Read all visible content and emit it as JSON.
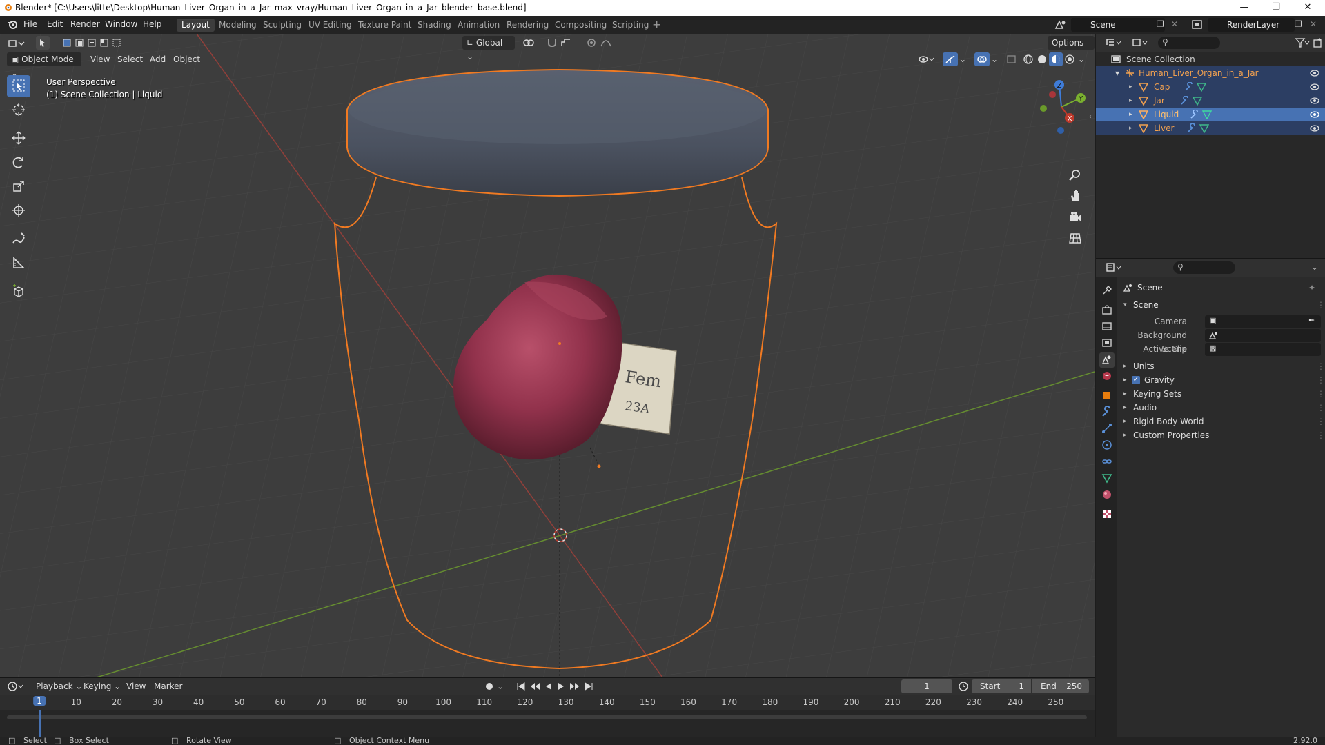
{
  "window": {
    "title": "Blender* [C:\\Users\\litte\\Desktop\\Human_Liver_Organ_in_a_Jar_max_vray/Human_Liver_Organ_in_a_Jar_blender_base.blend]"
  },
  "menu": [
    "File",
    "Edit",
    "Render",
    "Window",
    "Help"
  ],
  "workspaces": [
    "Layout",
    "Modeling",
    "Sculpting",
    "UV Editing",
    "Texture Paint",
    "Shading",
    "Animation",
    "Rendering",
    "Compositing",
    "Scripting"
  ],
  "active_workspace": "Layout",
  "scene_field": "Scene",
  "render_layer_field": "RenderLayer",
  "viewport": {
    "mode": "Object Mode",
    "menus": [
      "View",
      "Select",
      "Add",
      "Object"
    ],
    "orientation": "Global",
    "options_label": "Options",
    "info_line1": "User Perspective",
    "info_line2": "(1) Scene Collection | Liquid",
    "gizmo_axes": [
      "Z",
      "Y",
      "X"
    ],
    "label_card_text": "Fem 23A"
  },
  "outliner": {
    "root": "Scene Collection",
    "collection": "Human_Liver_Organ_in_a_Jar",
    "items": [
      "Cap",
      "Jar",
      "Liquid",
      "Liver"
    ],
    "selected": "Liquid"
  },
  "properties": {
    "context_title": "Scene",
    "panel_title": "Scene",
    "camera_label": "Camera",
    "background_scene_label": "Background Scene",
    "active_clip_label": "Active Clip",
    "sections": [
      "Units",
      "Gravity",
      "Keying Sets",
      "Audio",
      "Rigid Body World",
      "Custom Properties"
    ],
    "gravity_checked": true
  },
  "timeline": {
    "menus": [
      "Playback",
      "Keying",
      "View",
      "Marker"
    ],
    "current_frame": "1",
    "start_label": "Start",
    "start_value": "1",
    "end_label": "End",
    "end_value": "250",
    "ticks": [
      "10",
      "20",
      "30",
      "40",
      "50",
      "60",
      "70",
      "80",
      "90",
      "100",
      "110",
      "120",
      "130",
      "140",
      "150",
      "160",
      "170",
      "180",
      "190",
      "200",
      "210",
      "220",
      "230",
      "240",
      "250"
    ],
    "playhead": "1"
  },
  "statusbar": {
    "select": "Select",
    "box_select": "Box Select",
    "rotate_view": "Rotate View",
    "context_menu": "Object Context Menu",
    "version": "2.92.0"
  },
  "colors": {
    "accent_blue": "#4772b3",
    "selection_orange": "#f07a22",
    "x_axis": "#c0392b",
    "y_axis": "#7ab02f",
    "z_axis": "#3f7cd8"
  }
}
